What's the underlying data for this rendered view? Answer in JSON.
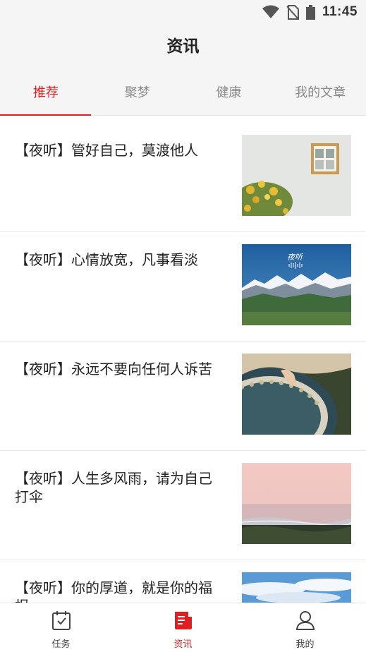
{
  "status_bar": {
    "time": "11:45",
    "icons": [
      "wifi-icon",
      "no-sim-icon",
      "battery-icon"
    ]
  },
  "header": {
    "title": "资讯"
  },
  "tabs": [
    {
      "label": "推荐",
      "active": true
    },
    {
      "label": "聚梦",
      "active": false
    },
    {
      "label": "健康",
      "active": false
    },
    {
      "label": "我的文章",
      "active": false
    }
  ],
  "articles": [
    {
      "title": "【夜听】管好自己，莫渡他人",
      "thumbnail": "window-and-yellow-flowers"
    },
    {
      "title": "【夜听】心情放宽，凡事看淡",
      "thumbnail": "snowy-mountains",
      "thumbnail_text": "夜听"
    },
    {
      "title": "【夜听】永远不要向任何人诉苦",
      "thumbnail": "hand-and-mosaic-bowl"
    },
    {
      "title": "【夜听】人生多风雨，请为自己打伞",
      "thumbnail": "pink-sea-shore"
    },
    {
      "title": "【夜听】你的厚道，就是你的福报",
      "thumbnail": "blue-sky-clouds"
    }
  ],
  "bottom_nav": [
    {
      "label": "任务",
      "icon": "calendar-check-icon",
      "active": false
    },
    {
      "label": "资讯",
      "icon": "news-icon",
      "active": true
    },
    {
      "label": "我的",
      "icon": "person-icon",
      "active": false
    }
  ],
  "colors": {
    "accent": "#e02020",
    "header_bg": "#f5f5f5"
  }
}
